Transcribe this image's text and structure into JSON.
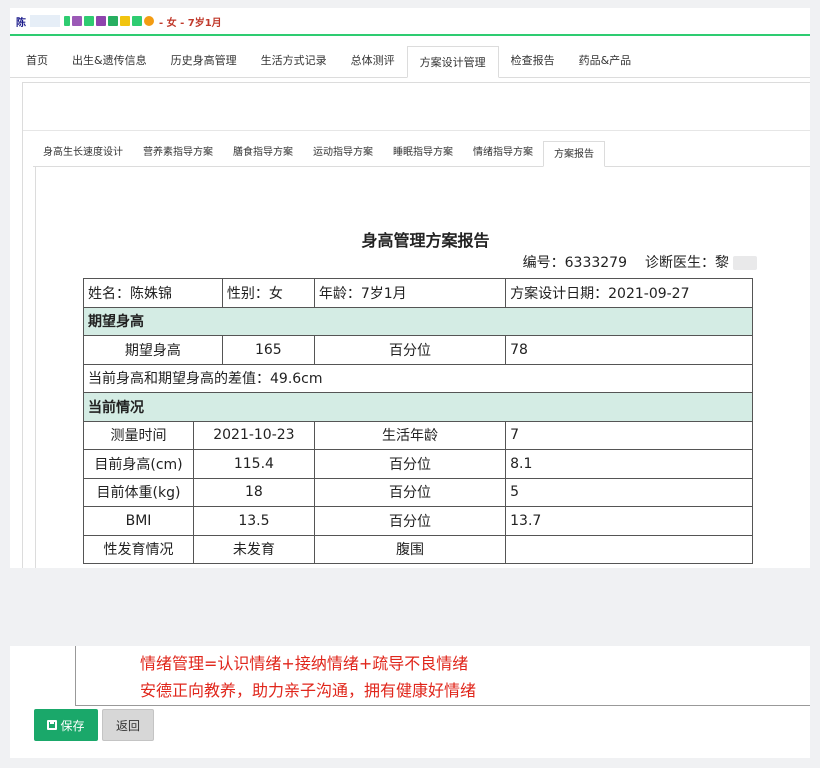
{
  "patient_bar": {
    "name_char": "陈",
    "info": "- 女 - 7岁1月",
    "icon_colors": [
      "#9b59b6",
      "#2ecc71",
      "#3498db",
      "#e67e22",
      "#2ecc71",
      "#f1c40f",
      "#f39c12"
    ]
  },
  "main_tabs": [
    "首页",
    "出生&遗传信息",
    "历史身高管理",
    "生活方式记录",
    "总体测评",
    "方案设计管理",
    "检查报告",
    "药品&产品"
  ],
  "sub_tabs": [
    "身高生长速度设计",
    "营养素指导方案",
    "膳食指导方案",
    "运动指导方案",
    "睡眠指导方案",
    "情绪指导方案",
    "方案报告"
  ],
  "report": {
    "title": "身高管理方案报告",
    "number_label": "编号：6333279",
    "doctor_label": "诊断医生：",
    "doctor_char": "黎",
    "name": "姓名：陈姝锦",
    "gender": "性别：女",
    "age": "年龄：7岁1月",
    "design_date": "方案设计日期：2021-09-27",
    "section_expected": "期望身高",
    "expected_height_label": "期望身高",
    "expected_height_value": "165",
    "expected_pct_label": "百分位",
    "expected_pct_value": "78",
    "diff": "当前身高和期望身高的差值：49.6cm",
    "section_current": "当前情况",
    "rows": [
      {
        "label": "测量时间",
        "value": "2021-10-23",
        "label2": "生活年龄",
        "value2": "7"
      },
      {
        "label": "目前身高(cm)",
        "value": "115.4",
        "label2": "百分位",
        "value2": "8.1"
      },
      {
        "label": "目前体重(kg)",
        "value": "18",
        "label2": "百分位",
        "value2": "5"
      },
      {
        "label": "BMI",
        "value": "13.5",
        "label2": "百分位",
        "value2": "13.7"
      },
      {
        "label": "性发育情况",
        "value": "未发育",
        "label2": "腹围",
        "value2": ""
      }
    ]
  },
  "slogans": [
    "情绪管理=认识情绪+接纳情绪+疏导不良情绪",
    "安德正向教养，助力亲子沟通，拥有健康好情绪"
  ],
  "buttons": {
    "save": "保存",
    "back": "返回"
  }
}
